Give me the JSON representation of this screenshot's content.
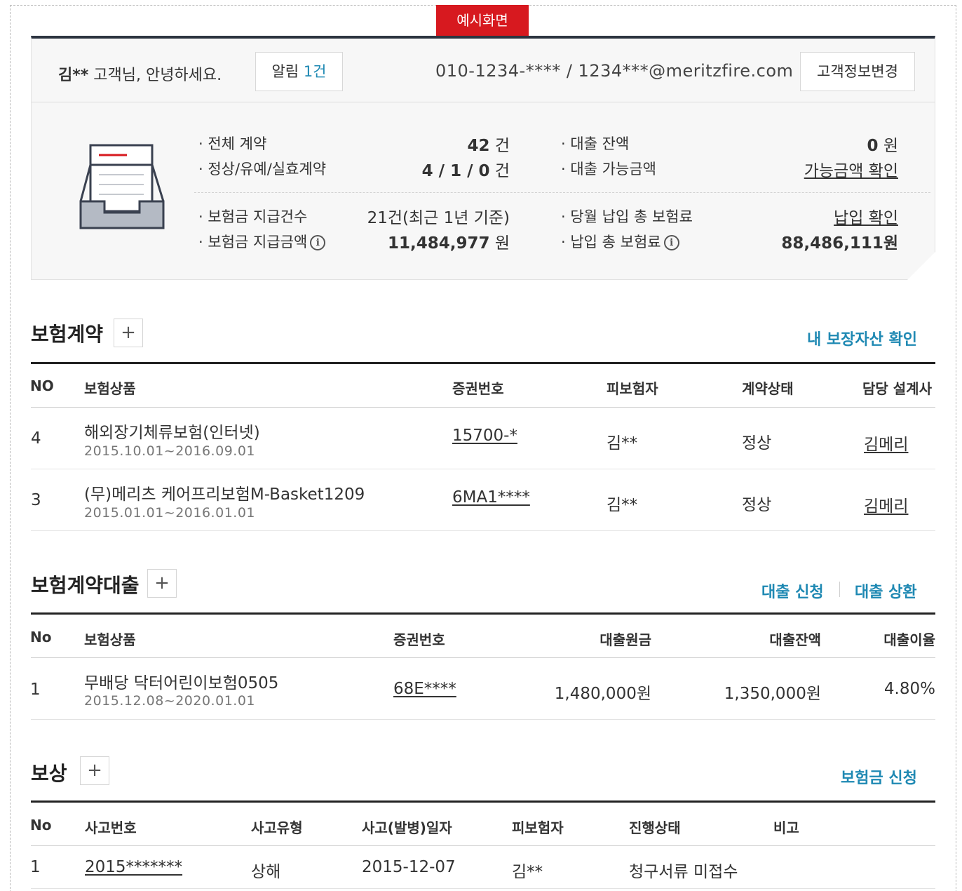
{
  "sample_tag": "예시화면",
  "header": {
    "customer_name": "김**",
    "greeting": "고객님, 안녕하세요.",
    "alarm_label": "알림",
    "alarm_count": "1건",
    "contact": "010-1234-**** / 1234***@meritzfire.com",
    "edit_button": "고객정보변경"
  },
  "summary": {
    "total_contracts_label": "전체 계약",
    "total_contracts_value": "42",
    "total_contracts_unit": "건",
    "status_label": "정상/유예/실효계약",
    "status_value": "4 / 1 / 0",
    "status_unit": "건",
    "loan_balance_label": "대출 잔액",
    "loan_balance_value": "0",
    "loan_balance_unit": "원",
    "loan_available_label": "대출 가능금액",
    "loan_available_link": "가능금액 확인",
    "claim_count_label": "보험금 지급건수",
    "claim_count_value": "21건(최근 1년 기준)",
    "claim_amount_label": "보험금 지급금액",
    "claim_amount_value": "11,484,977",
    "claim_amount_unit": "원",
    "monthly_premium_label": "당월 납입 총 보험료",
    "monthly_premium_link": "납입 확인",
    "total_premium_label": "납입 총 보험료",
    "total_premium_value": "88,486,111원"
  },
  "contracts": {
    "title": "보험계약",
    "link": "내 보장자산 확인",
    "headers": [
      "NO",
      "보험상품",
      "증권번호",
      "피보험자",
      "계약상태",
      "담당 설계사"
    ],
    "rows": [
      {
        "no": "4",
        "product": "해외장기체류보험(인터넷)",
        "period": "2015.10.01~2016.09.01",
        "policy": "15700-*",
        "insured": "김**",
        "status": "정상",
        "agent": "김메리"
      },
      {
        "no": "3",
        "product": "(무)메리츠 케어프리보험M-Basket1209",
        "period": "2015.01.01~2016.01.01",
        "policy": "6MA1****",
        "insured": "김**",
        "status": "정상",
        "agent": "김메리"
      }
    ]
  },
  "loans": {
    "title": "보험계약대출",
    "link_apply": "대출 신청",
    "link_repay": "대출 상환",
    "headers": [
      "No",
      "보험상품",
      "증권번호",
      "대출원금",
      "대출잔액",
      "대출이율"
    ],
    "rows": [
      {
        "no": "1",
        "product": "무배당 닥터어린이보험0505",
        "period": "2015.12.08~2020.01.01",
        "policy": "68E****",
        "principal": "1,480,000원",
        "balance": "1,350,000원",
        "rate": "4.80%"
      }
    ]
  },
  "claims": {
    "title": "보상",
    "link": "보험금 신청",
    "headers": [
      "No",
      "사고번호",
      "사고유형",
      "사고(발병)일자",
      "피보험자",
      "진행상태",
      "비고"
    ],
    "rows": [
      {
        "no": "1",
        "accident_no": "2015*******",
        "type": "상해",
        "date": "2015-12-07",
        "insured": "김**",
        "status": "청구서류 미접수",
        "note": ""
      }
    ]
  },
  "colors": {
    "accent_red": "#d7191f",
    "link_blue": "#1f89b3",
    "dark_bar": "#2c3440"
  }
}
